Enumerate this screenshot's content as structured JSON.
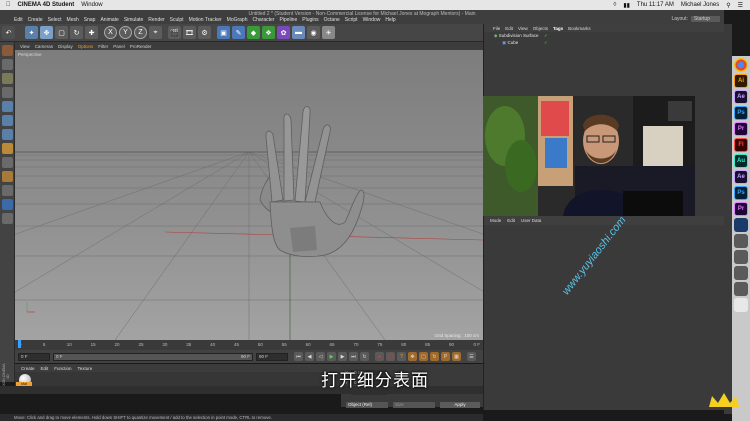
{
  "mac_menubar": {
    "app_name": "CINEMA 4D Student",
    "window_menu": "Window",
    "time": "Thu 11:17 AM",
    "user": "Michael Jones"
  },
  "window": {
    "title": "Untitled 2 * (Student Version - Non-Commercial License for Michael Jones at Mograph Mentors) - Main"
  },
  "c4d_menu": [
    "Edit",
    "Create",
    "Select",
    "Mesh",
    "Snap",
    "Animate",
    "Simulate",
    "Render",
    "Sculpt",
    "Motion Tracker",
    "MoGraph",
    "Character",
    "Pipeline",
    "Plugins",
    "Octane",
    "Script",
    "Window",
    "Help"
  ],
  "layout": {
    "label": "Layout:",
    "value": "Startup"
  },
  "toolbar": {
    "axis_x": "X",
    "axis_y": "Y",
    "axis_z": "Z"
  },
  "viewport": {
    "menu": [
      "View",
      "Cameras",
      "Display",
      "Options",
      "Filter",
      "Panel",
      "ProRender"
    ],
    "active_menu": "Options",
    "name": "Perspective",
    "grid_spacing": "Grid Spacing : 100 cm"
  },
  "timeline": {
    "ticks": [
      "0",
      "5",
      "10",
      "15",
      "20",
      "25",
      "30",
      "35",
      "40",
      "45",
      "50",
      "55",
      "60",
      "65",
      "70",
      "75",
      "80",
      "85",
      "90"
    ],
    "end_frame_label": "0 F",
    "current_frame": "0 F",
    "start_field": "0 F",
    "end_field": "90 F",
    "end_field2": "90 F"
  },
  "material_manager": {
    "menu": [
      "Create",
      "Edit",
      "Function",
      "Texture"
    ],
    "material_name": "Mat"
  },
  "coordinates": {
    "rows": [
      {
        "axis": "X",
        "val": "0 cm"
      },
      {
        "axis": "Y",
        "val": "0 cm"
      },
      {
        "axis": "Z",
        "val": "0 cm"
      }
    ],
    "object_mode": "Object (Rel)",
    "size_mode": "Size",
    "apply": "Apply"
  },
  "status": {
    "text": "Move: Click and drag to move elements. Hold down SHIFT to quantize movement / add to the selection in point mode, CTRL to remove."
  },
  "object_manager": {
    "menu": [
      "File",
      "Edit",
      "View",
      "Objects",
      "Tags",
      "Bookmarks"
    ],
    "active_menu": "Tags",
    "objects": [
      {
        "name": "Subdivision Surface"
      },
      {
        "name": "Cube"
      }
    ]
  },
  "attribute_manager": {
    "menu": [
      "Mode",
      "Edit",
      "User Data"
    ]
  },
  "dock_apps": [
    {
      "icon": "ai-icon",
      "label": "Ai",
      "bg": "#2e1a00",
      "fg": "#ff9a00"
    },
    {
      "icon": "ae-icon",
      "label": "Ae",
      "bg": "#1a0f33",
      "fg": "#c5a3ff"
    },
    {
      "icon": "ps-icon",
      "label": "Ps",
      "bg": "#001e36",
      "fg": "#31a8ff"
    },
    {
      "icon": "pr-icon",
      "label": "Pr",
      "bg": "#1e0536",
      "fg": "#e07cff"
    },
    {
      "icon": "fl-icon",
      "label": "Fl",
      "bg": "#3a0000",
      "fg": "#ff4a4a"
    },
    {
      "icon": "au-icon",
      "label": "Au",
      "bg": "#002a2a",
      "fg": "#2cf0c8"
    },
    {
      "icon": "ae2-icon",
      "label": "Ae",
      "bg": "#1a0f33",
      "fg": "#c5a3ff"
    },
    {
      "icon": "ps2-icon",
      "label": "Ps",
      "bg": "#001e36",
      "fg": "#31a8ff"
    },
    {
      "icon": "pr2-icon",
      "label": "Pr",
      "bg": "#1e0536",
      "fg": "#e07cff"
    }
  ],
  "subtitle": "打开细分表面",
  "watermark": "www.yuyiaoshi.com",
  "colors": {
    "accent": "#f0a030",
    "subtitle": "#ffffff",
    "watermark": "#58c3e8"
  }
}
